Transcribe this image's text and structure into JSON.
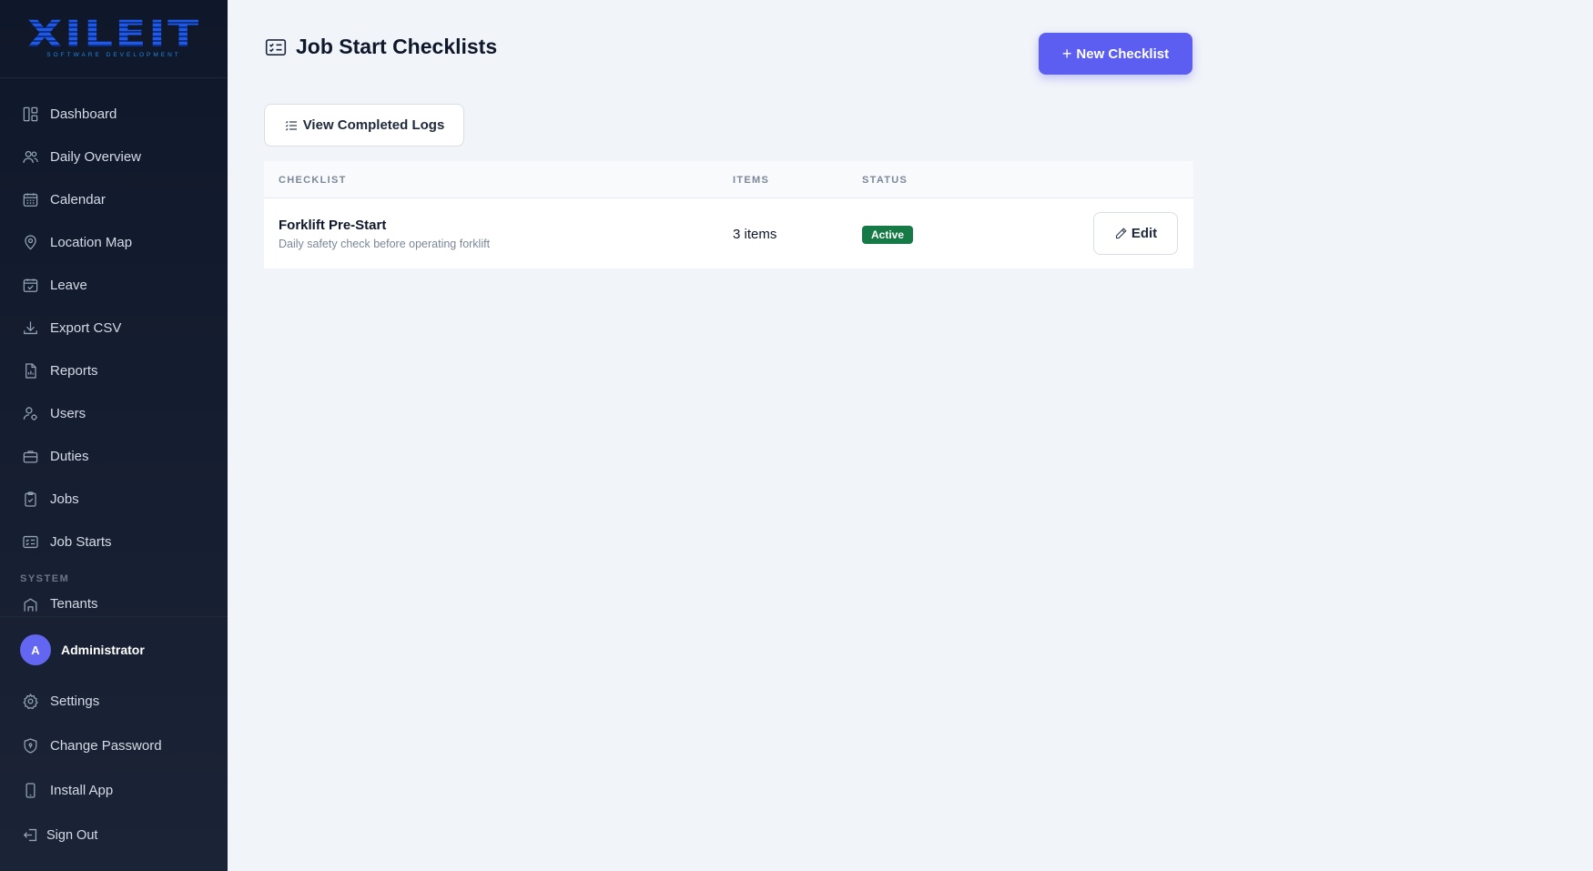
{
  "brand": {
    "logo_text": "XILEIT",
    "logo_sub": "SOFTWARE DEVELOPMENT"
  },
  "sidebar": {
    "items": [
      {
        "label": "Dashboard",
        "icon": "dashboard-icon"
      },
      {
        "label": "Daily Overview",
        "icon": "users-icon"
      },
      {
        "label": "Calendar",
        "icon": "calendar-icon"
      },
      {
        "label": "Location Map",
        "icon": "map-pin-icon"
      },
      {
        "label": "Leave",
        "icon": "calendar-check-icon"
      },
      {
        "label": "Export CSV",
        "icon": "download-icon"
      },
      {
        "label": "Reports",
        "icon": "report-icon"
      },
      {
        "label": "Users",
        "icon": "user-settings-icon"
      },
      {
        "label": "Duties",
        "icon": "briefcase-icon"
      },
      {
        "label": "Jobs",
        "icon": "clipboard-icon"
      },
      {
        "label": "Job Starts",
        "icon": "checklist-icon"
      }
    ],
    "section_system": "SYSTEM",
    "system_items": [
      {
        "label": "Tenants",
        "icon": "building-icon"
      }
    ],
    "user": {
      "initial": "A",
      "name": "Administrator"
    },
    "bottom_items": [
      {
        "label": "Settings",
        "icon": "gear-icon"
      },
      {
        "label": "Change Password",
        "icon": "shield-icon"
      },
      {
        "label": "Install App",
        "icon": "phone-icon"
      },
      {
        "label": "Sign Out",
        "icon": "sign-out-icon"
      }
    ]
  },
  "header": {
    "title": "Job Start Checklists",
    "new_button": "New Checklist"
  },
  "toolbar": {
    "logs_button": "View Completed Logs"
  },
  "table": {
    "columns": [
      "CHECKLIST",
      "ITEMS",
      "STATUS"
    ],
    "rows": [
      {
        "name": "Forklift Pre-Start",
        "description": "Daily safety check before operating forklift",
        "items": "3 items",
        "status": "Active",
        "action": "Edit"
      }
    ]
  },
  "colors": {
    "accent": "#5b5ef0",
    "active_badge": "#157a45",
    "sidebar_bg": "#0f172a"
  }
}
